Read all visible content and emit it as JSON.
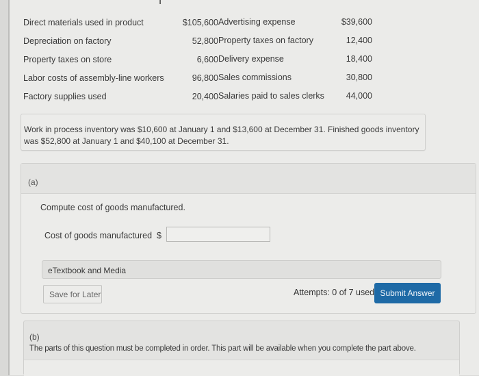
{
  "data_table": {
    "left_column": [
      {
        "label": "Direct materials used in product",
        "amount": "$105,600"
      },
      {
        "label": "Depreciation on factory",
        "amount": "52,800"
      },
      {
        "label": "Property taxes on store",
        "amount": "6,600"
      },
      {
        "label": "Labor costs of assembly-line workers",
        "amount": "96,800"
      },
      {
        "label": "Factory supplies used",
        "amount": "20,400"
      }
    ],
    "right_column": [
      {
        "label": "Advertising expense",
        "amount": "$39,600"
      },
      {
        "label": "Property taxes on factory",
        "amount": "12,400"
      },
      {
        "label": "Delivery expense",
        "amount": "18,400"
      },
      {
        "label": "Sales commissions",
        "amount": "30,800"
      },
      {
        "label": "Salaries paid to sales clerks",
        "amount": "44,000"
      }
    ]
  },
  "info": {
    "text": "Work in process inventory was $10,600 at January 1 and $13,600 at December 31. Finished goods inventory was $52,800 at January 1 and $40,100 at December 31."
  },
  "part_a": {
    "label": "(a)",
    "prompt": "Compute cost of goods manufactured.",
    "field_label": "Cost of goods manufactured",
    "currency": "$",
    "field_value": "",
    "etextbook_label": "eTextbook and Media",
    "save_label": "Save for Later",
    "attempts_text": "Attempts: 0 of 7 used",
    "submit_label": "Submit Answer"
  },
  "part_b": {
    "label": "(b)",
    "text": "The parts of this question must be completed in order. This part will be available when you complete the part above."
  },
  "colors": {
    "submit_button": "#1e6aa6",
    "page_background": "#ebebe9"
  }
}
